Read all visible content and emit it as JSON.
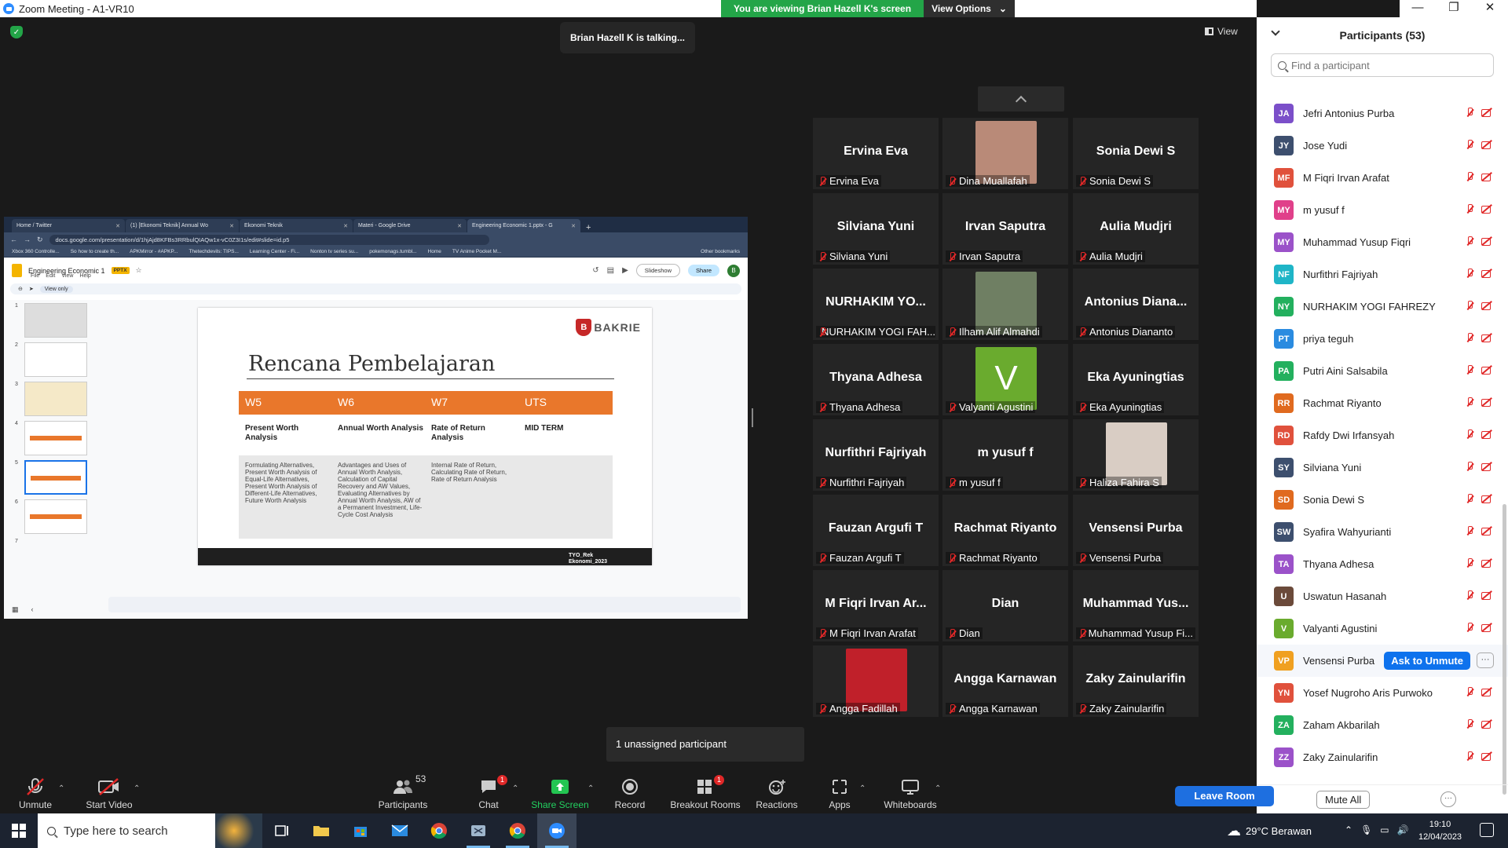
{
  "window": {
    "title": "Zoom Meeting - A1-VR10",
    "controls": [
      "—",
      "❐",
      "✕"
    ]
  },
  "banner": {
    "viewing": "You are viewing Brian Hazell K's screen",
    "view_options": "View Options"
  },
  "talking": "Brian Hazell K is talking...",
  "view_label": "View",
  "browser": {
    "tabs": [
      "Home / Twitter",
      "(1) [Ekonomi Teknik] Annual Wo",
      "Ekonomi Teknik",
      "Materi - Google Drive",
      "Engineering Economic 1.pptx - G"
    ],
    "url": "docs.google.com/presentation/d/1hjAjd8KFBs3RRbulQIAQw1x-vC0Z3I1s/edit#slide=id.p5",
    "bookmarks": [
      "Xbox 360 Controlle...",
      "So how to create th...",
      "APKMirror - #APKP...",
      "Thetechdevils: TIPS...",
      "Learning Center - Fi...",
      "Nonton tv series su...",
      "pokemonags.tumbl...",
      "Home",
      "TV Anime Pocket M...",
      "Other bookmarks"
    ]
  },
  "slides_app": {
    "doc_name": "Engineering Economic 1",
    "badge": "PPTX",
    "menu": [
      "File",
      "Edit",
      "View",
      "Help"
    ],
    "slideshow": "Slideshow",
    "share": "Share",
    "avatar": "B",
    "view_only": "View only",
    "thumb_numbers": [
      "1",
      "2",
      "3",
      "4",
      "5",
      "6",
      "7"
    ]
  },
  "slide": {
    "logo_small": "UNIVERSITAS",
    "logo_text": "BAKRIE",
    "title": "Rencana Pembelajaran",
    "weeks": [
      {
        "code": "W5",
        "topic": "Present Worth Analysis",
        "desc": "Formulating Alternatives, Present Worth Analysis of Equal-Life Alternatives, Present Worth Analysis of Different-Life Alternatives, Future Worth Analysis"
      },
      {
        "code": "W6",
        "topic": "Annual Worth Analysis",
        "desc": "Advantages and Uses of Annual Worth Analysis, Calculation of Capital Recovery and AW Values, Evaluating Alternatives by Annual Worth Analysis, AW of a Permanent Investment, Life-Cycle Cost Analysis"
      },
      {
        "code": "W7",
        "topic": "Rate of Return Analysis",
        "desc": "Internal Rate of Return, Calculating Rate of Return, Rate of Return Analysis"
      },
      {
        "code": "UTS",
        "topic": "MID TERM",
        "desc": ""
      }
    ],
    "footer": "TYO_Rek Ekonomi_2023"
  },
  "tiles": [
    {
      "name": "Ervina Eva",
      "label": "Ervina Eva"
    },
    {
      "name": "",
      "label": "Dina Muallafah",
      "photo": "#b98a78"
    },
    {
      "name": "Sonia Dewi S",
      "label": "Sonia Dewi S"
    },
    {
      "name": "Silviana Yuni",
      "label": "Silviana Yuni"
    },
    {
      "name": "Irvan Saputra",
      "label": "Irvan Saputra"
    },
    {
      "name": "Aulia Mudjri",
      "label": "Aulia Mudjri"
    },
    {
      "name": "NURHAKIM YO...",
      "label": "NURHAKIM YOGI FAH..."
    },
    {
      "name": "",
      "label": "Ilham Alif Almahdi",
      "photo": "#6f7f63"
    },
    {
      "name": "Antonius Diana...",
      "label": "Antonius Dianantо"
    },
    {
      "name": "Thyana Adhesa",
      "label": "Thyana Adhesa"
    },
    {
      "name": "V",
      "label": "Valyanti Agustini",
      "avatar": "#6aab2e"
    },
    {
      "name": "Eka Ayuningtias",
      "label": "Eka Ayuningtias"
    },
    {
      "name": "Nurfithri Fajriyah",
      "label": "Nurfithri Fajriyah"
    },
    {
      "name": "m yusuf f",
      "label": "m yusuf f"
    },
    {
      "name": "",
      "label": "Haliza Fahira S",
      "photo": "#d9cdc4"
    },
    {
      "name": "Fauzan Argufi T",
      "label": "Fauzan Argufi T"
    },
    {
      "name": "Rachmat Riyanto",
      "label": "Rachmat Riyanto"
    },
    {
      "name": "Vensensi Purba",
      "label": "Vensensi Purba"
    },
    {
      "name": "M Fiqri Irvan Ar...",
      "label": "M Fiqri Irvan Arafat"
    },
    {
      "name": "Dian",
      "label": "Dian"
    },
    {
      "name": "Muhammad Yus...",
      "label": "Muhammad Yusup Fi..."
    },
    {
      "name": "",
      "label": "Angga Fadillah",
      "photo": "#c0202a"
    },
    {
      "name": "Angga Karnawan",
      "label": "Angga Karnawan"
    },
    {
      "name": "Zaky Zainularifin",
      "label": "Zaky Zainularifin"
    }
  ],
  "unassigned": "1 unassigned participant",
  "participants": {
    "title": "Participants (53)",
    "search_placeholder": "Find a participant",
    "ask_unmute": "Ask to Unmute",
    "mute_all": "Mute All",
    "list": [
      {
        "initials": "JA",
        "name": "Jefri Antonius Purba",
        "color": "#7b4fc9"
      },
      {
        "initials": "JY",
        "name": "Jose Yudi",
        "color": "#3d4f6e"
      },
      {
        "initials": "MF",
        "name": "M Fiqri Irvan Arafat",
        "color": "#e0513c"
      },
      {
        "initials": "MY",
        "name": "m yusuf f",
        "color": "#e0408a"
      },
      {
        "initials": "MY",
        "name": "Muhammad Yusup Fiqri",
        "color": "#9b52c9"
      },
      {
        "initials": "NF",
        "name": "Nurfithri Fajriyah",
        "color": "#1fb5c7"
      },
      {
        "initials": "NY",
        "name": "NURHAKIM YOGI FAHREZY",
        "color": "#23b05e"
      },
      {
        "initials": "PT",
        "name": "priya teguh",
        "color": "#2a8be0"
      },
      {
        "initials": "PA",
        "name": "Putri Aini Salsabila",
        "color": "#23b05e"
      },
      {
        "initials": "RR",
        "name": "Rachmat Riyanto",
        "color": "#e06a1f"
      },
      {
        "initials": "RD",
        "name": "Rafdy Dwi Irfansyah",
        "color": "#e0513c"
      },
      {
        "initials": "SY",
        "name": "Silviana Yuni",
        "color": "#3d4f6e"
      },
      {
        "initials": "SD",
        "name": "Sonia Dewi S",
        "color": "#e06a1f"
      },
      {
        "initials": "SW",
        "name": "Syafira Wahyurianti",
        "color": "#3d4f6e"
      },
      {
        "initials": "TA",
        "name": "Thyana Adhesa",
        "color": "#9b52c9"
      },
      {
        "initials": "U",
        "name": "Uswatun Hasanah",
        "color": "#6b4a3a"
      },
      {
        "initials": "V",
        "name": "Valyanti Agustini",
        "color": "#6aab2e"
      },
      {
        "initials": "VP",
        "name": "Vensensi Purba",
        "color": "#f0a020"
      },
      {
        "initials": "YN",
        "name": "Yosef Nugroho Aris Purwoko",
        "color": "#e0513c"
      },
      {
        "initials": "ZA",
        "name": "Zaham Akbarilah",
        "color": "#23b05e"
      },
      {
        "initials": "ZZ",
        "name": "Zaky Zainularifin",
        "color": "#9b52c9"
      }
    ]
  },
  "toolbar": {
    "unmute": "Unmute",
    "start_video": "Start Video",
    "participants": "Participants",
    "participants_count": "53",
    "chat": "Chat",
    "chat_badge": "1",
    "share_screen": "Share Screen",
    "record": "Record",
    "breakout": "Breakout Rooms",
    "breakout_badge": "1",
    "reactions": "Reactions",
    "apps": "Apps",
    "whiteboards": "Whiteboards",
    "leave": "Leave Room"
  },
  "taskbar": {
    "search_placeholder": "Type here to search",
    "weather": "29°C  Berawan",
    "time": "19:10",
    "date": "12/04/2023"
  }
}
